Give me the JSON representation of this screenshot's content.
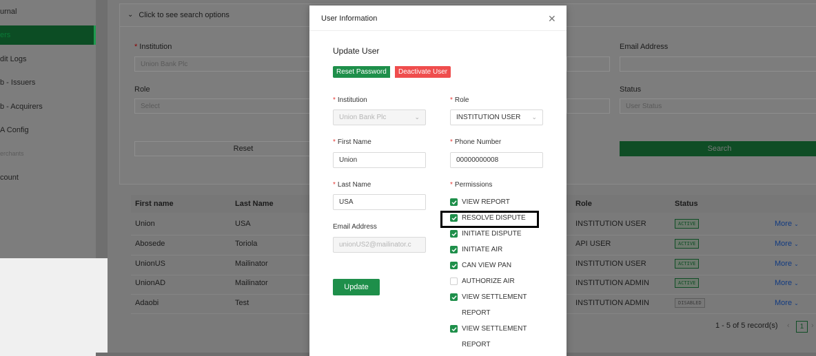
{
  "sidebar": {
    "items": [
      {
        "label": "urnal"
      },
      {
        "label": "ers"
      },
      {
        "label": "dit Logs"
      },
      {
        "label": "b - Issuers"
      },
      {
        "label": "b - Acquirers"
      },
      {
        "label": "A Config"
      },
      {
        "label": "erchants"
      },
      {
        "label": "count"
      }
    ]
  },
  "search": {
    "toggle_label": "Click to see search options",
    "institution_label": "Institution",
    "institution_value": "Union Bank Plc",
    "email_label": "Email Address",
    "role_label": "Role",
    "role_placeholder": "Select",
    "status_label": "Status",
    "status_placeholder": "User Status",
    "reset_label": "Reset",
    "search_label": "Search"
  },
  "table": {
    "headers": {
      "first_name": "First name",
      "last_name": "Last Name",
      "role": "Role",
      "status": "Status"
    },
    "rows": [
      {
        "first": "Union",
        "last": "USA",
        "role": "INSTITUTION USER",
        "status": "ACTIVE",
        "more": "More"
      },
      {
        "first": "Abosede",
        "last": "Toriola",
        "role": "API USER",
        "status": "ACTIVE",
        "more": "More"
      },
      {
        "first": "UnionUS",
        "last": "Mailinator",
        "role": "INSTITUTION USER",
        "status": "ACTIVE",
        "more": "More"
      },
      {
        "first": "UnionAD",
        "last": "Mailinator",
        "role": "INSTITUTION ADMIN",
        "status": "ACTIVE",
        "more": "More"
      },
      {
        "first": "Adaobi",
        "last": "Test",
        "role": "INSTITUTION ADMIN",
        "status": "DISABLED",
        "more": "More"
      }
    ],
    "pagination": {
      "summary": "1 - 5 of 5 record(s)",
      "current_page": "1"
    }
  },
  "modal": {
    "title": "User Information",
    "section_title": "Update User",
    "reset_password_label": "Reset Password",
    "deactivate_label": "Deactivate User",
    "institution_label": "Institution",
    "institution_value": "Union Bank Plc",
    "role_label": "Role",
    "role_value": "INSTITUTION USER",
    "first_name_label": "First Name",
    "first_name_value": "Union",
    "phone_label": "Phone Number",
    "phone_value": "00000000008",
    "last_name_label": "Last Name",
    "last_name_value": "USA",
    "email_label": "Email Address",
    "email_value": "unionUS2@mailinator.c",
    "permissions_label": "Permissions",
    "permissions": [
      {
        "label": "VIEW REPORT",
        "checked": true
      },
      {
        "label": "RESOLVE DISPUTE",
        "checked": true
      },
      {
        "label": "INITIATE DISPUTE",
        "checked": true
      },
      {
        "label": "INITIATE AIR",
        "checked": true
      },
      {
        "label": "CAN VIEW PAN",
        "checked": true
      },
      {
        "label": "AUTHORIZE AIR",
        "checked": false
      },
      {
        "label": "VIEW SETTLEMENT REPORT",
        "checked": true
      },
      {
        "label": "VIEW SETTLEMENT REPORT",
        "checked": true
      }
    ],
    "update_label": "Update"
  },
  "colors": {
    "primary_green": "#1e8f4a",
    "danger_red": "#ef4d4d"
  }
}
